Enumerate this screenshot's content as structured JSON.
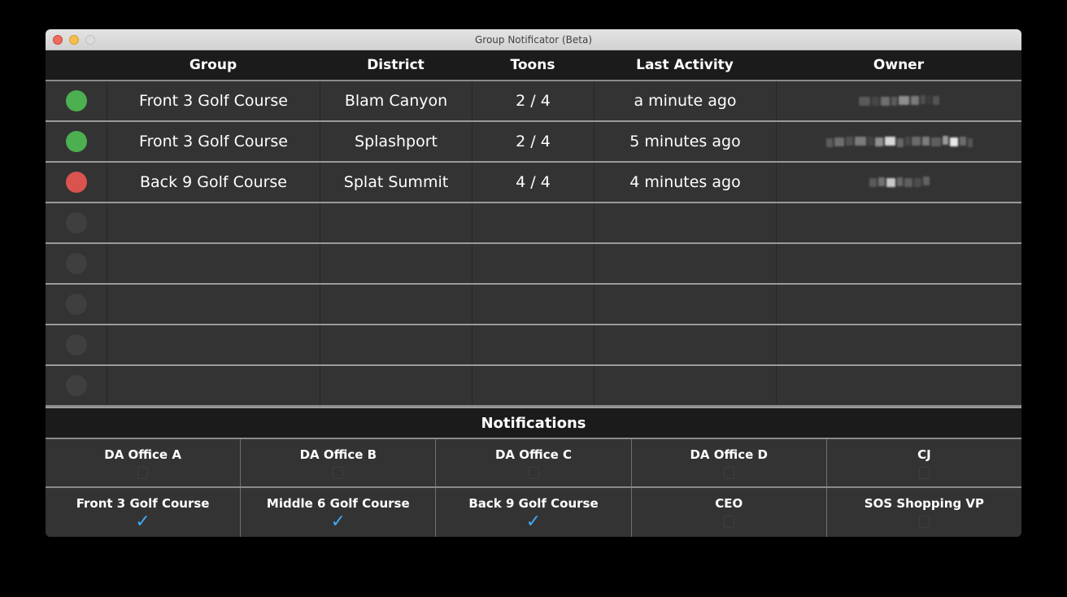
{
  "window": {
    "title": "Group Notificator (Beta)",
    "controls": {
      "close": "close-button",
      "minimize": "minimize-button",
      "maximize": "maximize-button"
    }
  },
  "table": {
    "columns": [
      "",
      "Group",
      "District",
      "Toons",
      "Last Activity",
      "Owner"
    ],
    "headers": {
      "status": "",
      "group": "Group",
      "district": "District",
      "toons": "Toons",
      "activity": "Last Activity",
      "owner": "Owner"
    },
    "rows": [
      {
        "status": "online",
        "status_color": "#4CAF50",
        "group": "Front 3 Golf Course",
        "district": "Blam Canyon",
        "toons": "2 / 4",
        "activity": "a minute ago",
        "owner_redacted": true
      },
      {
        "status": "online",
        "status_color": "#4CAF50",
        "group": "Front 3 Golf Course",
        "district": "Splashport",
        "toons": "2 / 4",
        "activity": "5 minutes ago",
        "owner_redacted": true
      },
      {
        "status": "full",
        "status_color": "#D9534F",
        "group": "Back 9 Golf Course",
        "district": "Splat Summit",
        "toons": "4 / 4",
        "activity": "4 minutes ago",
        "owner_redacted": true
      },
      {
        "status": "empty",
        "status_color": "#3f3f3f",
        "group": "",
        "district": "",
        "toons": "",
        "activity": "",
        "owner_redacted": false
      },
      {
        "status": "empty",
        "status_color": "#3f3f3f",
        "group": "",
        "district": "",
        "toons": "",
        "activity": "",
        "owner_redacted": false
      },
      {
        "status": "empty",
        "status_color": "#3f3f3f",
        "group": "",
        "district": "",
        "toons": "",
        "activity": "",
        "owner_redacted": false
      },
      {
        "status": "empty",
        "status_color": "#3f3f3f",
        "group": "",
        "district": "",
        "toons": "",
        "activity": "",
        "owner_redacted": false
      },
      {
        "status": "empty",
        "status_color": "#3f3f3f",
        "group": "",
        "district": "",
        "toons": "",
        "activity": "",
        "owner_redacted": false
      }
    ]
  },
  "notifications": {
    "title": "Notifications",
    "row1": [
      {
        "label": "DA Office A",
        "checked": false
      },
      {
        "label": "DA Office B",
        "checked": false
      },
      {
        "label": "DA Office C",
        "checked": false
      },
      {
        "label": "DA Office D",
        "checked": false
      },
      {
        "label": "CJ",
        "checked": false
      }
    ],
    "row2": [
      {
        "label": "Front 3 Golf Course",
        "checked": true
      },
      {
        "label": "Middle 6 Golf Course",
        "checked": true
      },
      {
        "label": "Back 9 Golf Course",
        "checked": true
      },
      {
        "label": "CEO",
        "checked": false
      },
      {
        "label": "SOS Shopping VP",
        "checked": false
      }
    ],
    "check_glyph": "✓",
    "check_color": "#3FA9F5"
  }
}
